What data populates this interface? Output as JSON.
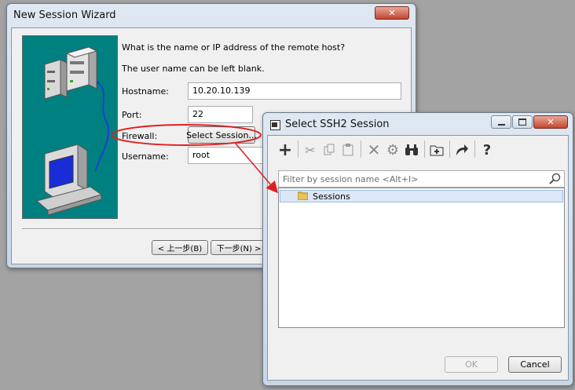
{
  "wizard": {
    "title": "New Session Wizard",
    "question": "What is the name or IP address of the remote host?",
    "note": "The user name can be left blank.",
    "hostname_label": "Hostname:",
    "hostname_value": "10.20.10.139",
    "port_label": "Port:",
    "port_value": "22",
    "firewall_label": "Firewall:",
    "firewall_button": "Select Session...",
    "username_label": "Username:",
    "username_value": "root",
    "back_button": "< 上一步(B)",
    "next_button": "下一步(N) >"
  },
  "select_dialog": {
    "title": "Select SSH2 Session",
    "filter_placeholder": "Filter by session name <Alt+I>",
    "tree_item": "Sessions",
    "ok_button": "OK",
    "cancel_button": "Cancel"
  },
  "colors": {
    "illustration_bg": "#008080",
    "annotation_red": "#e02020",
    "selection_bg": "#dce8f7"
  }
}
